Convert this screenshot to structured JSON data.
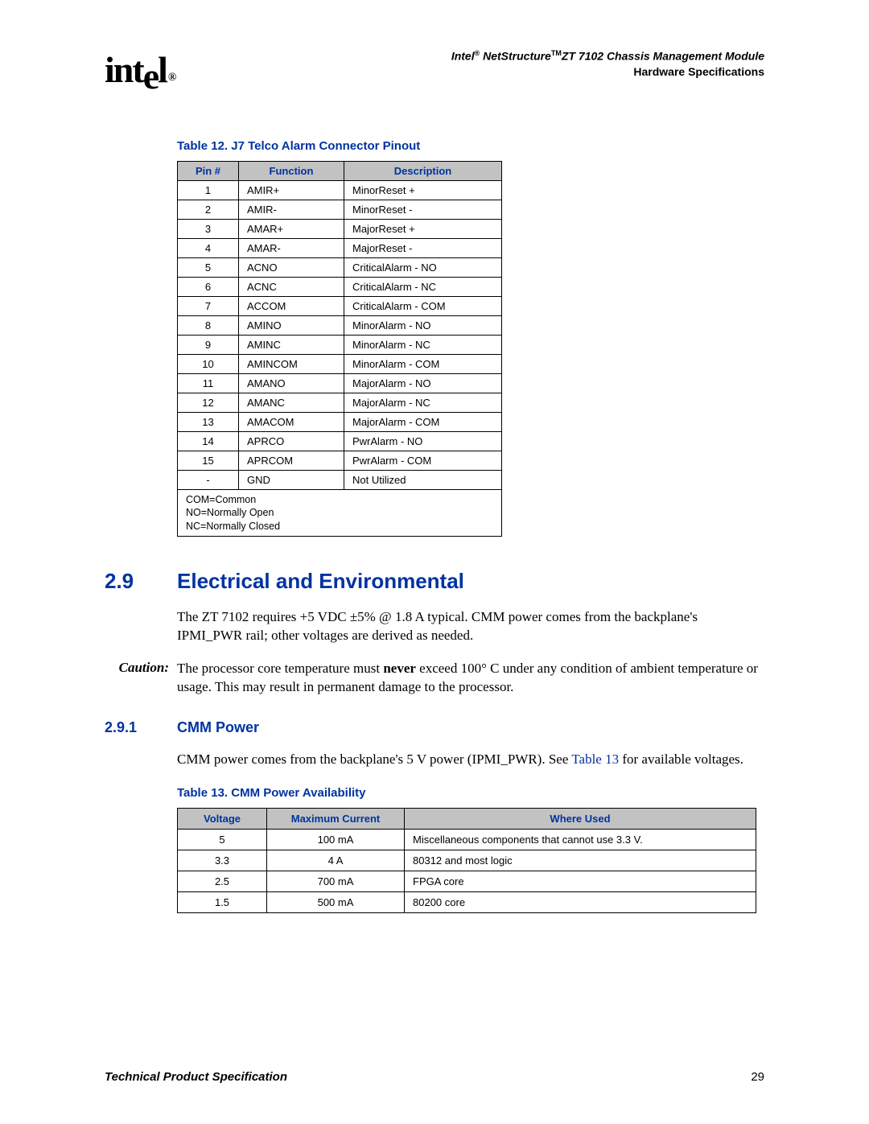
{
  "header": {
    "logo_text": "intel",
    "logo_reg": "®",
    "line1_a": "Intel",
    "line1_b": " NetStructure",
    "line1_c": "ZT 7102 Chassis Management Module",
    "sup_r": "®",
    "sup_tm": "TM",
    "line2": "Hardware Specifications"
  },
  "table12_caption": "Table 12.  J7 Telco Alarm Connector Pinout",
  "table12_headers": {
    "pin": "Pin #",
    "func": "Function",
    "desc": "Description"
  },
  "table12_rows": [
    {
      "pin": "1",
      "func": "AMIR+",
      "desc": "MinorReset +"
    },
    {
      "pin": "2",
      "func": "AMIR-",
      "desc": "MinorReset -"
    },
    {
      "pin": "3",
      "func": "AMAR+",
      "desc": "MajorReset +"
    },
    {
      "pin": "4",
      "func": "AMAR-",
      "desc": "MajorReset -"
    },
    {
      "pin": "5",
      "func": "ACNO",
      "desc": "CriticalAlarm - NO"
    },
    {
      "pin": "6",
      "func": "ACNC",
      "desc": "CriticalAlarm - NC"
    },
    {
      "pin": "7",
      "func": "ACCOM",
      "desc": "CriticalAlarm - COM"
    },
    {
      "pin": "8",
      "func": "AMINO",
      "desc": "MinorAlarm - NO"
    },
    {
      "pin": "9",
      "func": "AMINC",
      "desc": "MinorAlarm - NC"
    },
    {
      "pin": "10",
      "func": "AMINCOM",
      "desc": "MinorAlarm - COM"
    },
    {
      "pin": "11",
      "func": "AMANO",
      "desc": "MajorAlarm - NO"
    },
    {
      "pin": "12",
      "func": "AMANC",
      "desc": "MajorAlarm - NC"
    },
    {
      "pin": "13",
      "func": "AMACOM",
      "desc": "MajorAlarm - COM"
    },
    {
      "pin": "14",
      "func": "APRCO",
      "desc": "PwrAlarm - NO"
    },
    {
      "pin": "15",
      "func": "APRCOM",
      "desc": "PwrAlarm - COM"
    },
    {
      "pin": "-",
      "func": "GND",
      "desc": "Not Utilized"
    }
  ],
  "table12_legend": "COM=Common\nNO=Normally Open\nNC=Normally Closed",
  "section29_num": "2.9",
  "section29_title": "Electrical and Environmental",
  "section29_body": "The ZT 7102 requires +5 VDC ±5% @ 1.8 A typical. CMM power comes from the backplane's IPMI_PWR rail; other voltages are derived as needed.",
  "caution_label": "Caution:",
  "caution_a": "The processor core temperature must ",
  "caution_bold": "never",
  "caution_b": " exceed 100° C under any condition of ambient temperature or usage. This may result in permanent damage to the processor.",
  "section291_num": "2.9.1",
  "section291_title": "CMM Power",
  "section291_a": "CMM power comes from the backplane's 5 V power (IPMI_PWR). See ",
  "section291_link": "Table 13",
  "section291_b": " for available voltages.",
  "table13_caption": "Table 13.  CMM Power Availability",
  "table13_headers": {
    "volt": "Voltage",
    "curr": "Maximum Current",
    "where": "Where Used"
  },
  "table13_rows": [
    {
      "volt": "5",
      "curr": "100 mA",
      "where": "Miscellaneous components that cannot use 3.3 V."
    },
    {
      "volt": "3.3",
      "curr": "4 A",
      "where": "80312 and most logic"
    },
    {
      "volt": "2.5",
      "curr": "700 mA",
      "where": "FPGA core"
    },
    {
      "volt": "1.5",
      "curr": "500 mA",
      "where": "80200 core"
    }
  ],
  "footer": {
    "left": "Technical Product Specification",
    "right": "29"
  }
}
